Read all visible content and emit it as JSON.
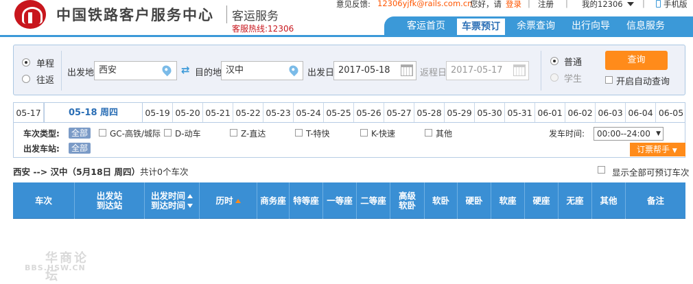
{
  "topbar": {
    "feedback_label": "意见反馈:",
    "feedback_email": "12306yjfk@rails.com.cn",
    "greeting": "您好，请",
    "login": "登录",
    "register": "注册",
    "my_account": "我的12306",
    "mobile": "手机版"
  },
  "header": {
    "brand": "中国铁路客户服务中心",
    "sub": "客运服务",
    "hotline": "客服热线:12306"
  },
  "nav": {
    "items": [
      "客运首页",
      "车票预订",
      "余票查询",
      "出行向导",
      "信息服务"
    ],
    "active": "车票预订"
  },
  "search": {
    "trip_single": "单程",
    "trip_round": "往返",
    "from_label": "出发地",
    "from_value": "西安",
    "to_label": "目的地",
    "to_value": "汉中",
    "depart_label": "出发日",
    "depart_value": "2017-05-18",
    "return_label": "返程日",
    "return_value": "2017-05-17",
    "type_normal": "普通",
    "type_student": "学生",
    "query_button": "查询",
    "auto_query": "开启自动查询"
  },
  "date_tabs": [
    "05-17",
    "05-18 周四",
    "05-19",
    "05-20",
    "05-21",
    "05-22",
    "05-23",
    "05-24",
    "05-25",
    "05-26",
    "05-27",
    "05-28",
    "05-29",
    "05-30",
    "05-31",
    "06-01",
    "06-02",
    "06-03",
    "06-04",
    "06-05"
  ],
  "filter": {
    "train_type_label": "车次类型:",
    "all_label": "全部",
    "types": [
      "GC-高铁/城际",
      "D-动车",
      "Z-直达",
      "T-特快",
      "K-快速",
      "其他"
    ],
    "station_label": "出发车站:",
    "station_all": "全部",
    "depart_time_label": "发车时间:",
    "depart_time_value": "00:00--24:00",
    "helper": "订票帮手"
  },
  "summary": {
    "route": "西安 --> 汉中（5月18日  周四）",
    "count": "共计0个车次",
    "show_all": "显示全部可预订车次"
  },
  "table_headers": {
    "train": "车次",
    "station_from": "出发站",
    "station_to": "到达站",
    "time_depart": "出发时间",
    "time_arrive": "到达时间",
    "duration": "历时",
    "business": "商务座",
    "premium": "特等座",
    "first": "一等座",
    "second": "二等座",
    "deluxe_line1": "高级",
    "deluxe_line2": "软卧",
    "soft_sleeper": "软卧",
    "hard_sleeper": "硬卧",
    "soft_seat": "软座",
    "hard_seat": "硬座",
    "no_seat": "无座",
    "other": "其他",
    "remark": "备注"
  },
  "watermark": {
    "line1": "华商论坛",
    "line2": "BBS.HSW.CN"
  },
  "colors": {
    "brand_red": "#c8161d",
    "nav_blue": "#3b99d8",
    "accent_orange": "#ff8b1a",
    "table_blue": "#3a8fd4"
  }
}
